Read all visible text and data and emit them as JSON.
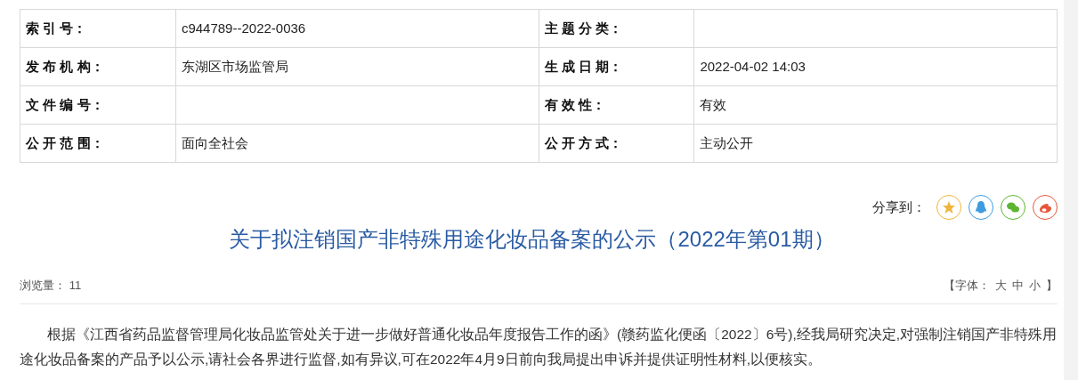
{
  "info_table": {
    "rows": [
      [
        {
          "label": "索 引 号：",
          "value": "c944789--2022-0036"
        },
        {
          "label": "主 题 分 类："
        }
      ],
      [
        {
          "label": "发 布 机 构：",
          "value": "东湖区市场监管局"
        },
        {
          "label": "生 成 日 期：",
          "value": "2022-04-02 14:03"
        }
      ],
      [
        {
          "label": "文 件 编 号："
        },
        {
          "label": "有 效 性：",
          "value": "有效"
        }
      ],
      [
        {
          "label": "公 开 范 围：",
          "value": "面向全社会"
        },
        {
          "label": "公 开 方 式：",
          "value": "主动公开"
        }
      ]
    ]
  },
  "share": {
    "label": "分享到：",
    "buttons": [
      {
        "kind": "star",
        "color": "#f0b43c"
      },
      {
        "kind": "penguin",
        "color": "#3d9be0"
      },
      {
        "kind": "chat",
        "color": "#5cb531"
      },
      {
        "kind": "swirl",
        "color": "#e8553a"
      }
    ]
  },
  "title": "关于拟注销国产非特殊用途化妆品备案的公示（2022年第01期）",
  "views": {
    "label": "浏览量：",
    "value": "11"
  },
  "font_size": {
    "open": "【字体：",
    "options": [
      "大",
      "中",
      "小"
    ],
    "close": "】"
  },
  "body": "根据《江西省药品监督管理局化妆品监管处关于进一步做好普通化妆品年度报告工作的函》(赣药监化便函〔2022〕6号),经我局研究决定,对强制注销国产非特殊用途化妆品备案的产品予以公示,请社会各界进行监督,如有异议,可在2022年4月9日前向我局提出申诉并提供证明性材料,以便核实。"
}
